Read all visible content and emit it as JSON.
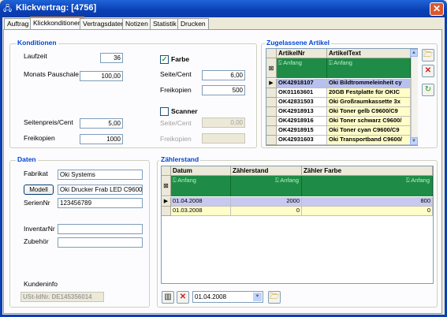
{
  "window": {
    "title": "Klickvertrag: [4756]",
    "close_glyph": "✕"
  },
  "tabs": [
    {
      "label": "Auftrag"
    },
    {
      "label": "Klickkonditionen"
    },
    {
      "label": "Vertragsdaten"
    },
    {
      "label": "Notizen"
    },
    {
      "label": "Statistik"
    },
    {
      "label": "Drucken"
    }
  ],
  "konditionen": {
    "title": "Konditionen",
    "laufzeit_label": "Laufzeit",
    "laufzeit_value": "36",
    "pauschale_label": "Monats Pauschale",
    "pauschale_value": "100,00",
    "seitenpreis_label": "Seitenpreis/Cent",
    "seitenpreis_value": "5,00",
    "freikopien_label": "Freikopien",
    "freikopien_value": "1000",
    "farbe": {
      "label": "Farbe",
      "checked": true,
      "seite_label": "Seite/Cent",
      "seite_value": "6,00",
      "frei_label": "Freikopien",
      "frei_value": "500"
    },
    "scanner": {
      "label": "Scanner",
      "checked": false,
      "seite_label": "Seite/Cent",
      "seite_value": "0,00",
      "frei_label": "Freikopien",
      "frei_value": ""
    }
  },
  "artikel": {
    "title": "Zugelassene Artikel",
    "columns": [
      "ArtikelNr",
      "ArtikelText"
    ],
    "filter_text": "Anfang",
    "rows": [
      {
        "nr": "OK42918107",
        "text": "Oki Bildtrommeleinheit cy",
        "selected": true
      },
      {
        "nr": "OK01163601",
        "text": "20GB Festplatte für OKIC"
      },
      {
        "nr": "OK42831503",
        "text": "Oki Großraumkassette 3x"
      },
      {
        "nr": "OK42918913",
        "text": "Oki Toner gelb C9600/C9"
      },
      {
        "nr": "OK42918916",
        "text": "Oki Toner schwarz C9600/"
      },
      {
        "nr": "OK42918915",
        "text": "Oki Toner cyan C9600/C9"
      },
      {
        "nr": "OK42931603",
        "text": "Oki Transportband C9600/"
      }
    ]
  },
  "daten": {
    "title": "Daten",
    "fabrikat_label": "Fabrikat",
    "fabrikat_value": "Oki Systems",
    "modell_button": "Modell",
    "modell_value": "Oki Drucker Frab LED C9600d",
    "seriennr_label": "SerienNr",
    "seriennr_value": "123456789",
    "inventarnr_label": "InventarNr",
    "inventarnr_value": "",
    "zubehoer_label": "Zubehör",
    "zubehoer_value": "",
    "kundeninfo_label": "Kundeninfo",
    "kundeninfo_value": "USt-IdNr. DE145356014"
  },
  "zaehlerstand": {
    "title": "Zählerstand",
    "columns": [
      "Datum",
      "Zählerstand",
      "Zähler Farbe"
    ],
    "filter_text": "Anfang",
    "rows": [
      {
        "datum": "01.04.2008",
        "stand": "2000",
        "farbe": "800",
        "selected": true
      },
      {
        "datum": "01.03.2008",
        "stand": "0",
        "farbe": "0"
      }
    ],
    "date_value": "01.04.2008"
  }
}
